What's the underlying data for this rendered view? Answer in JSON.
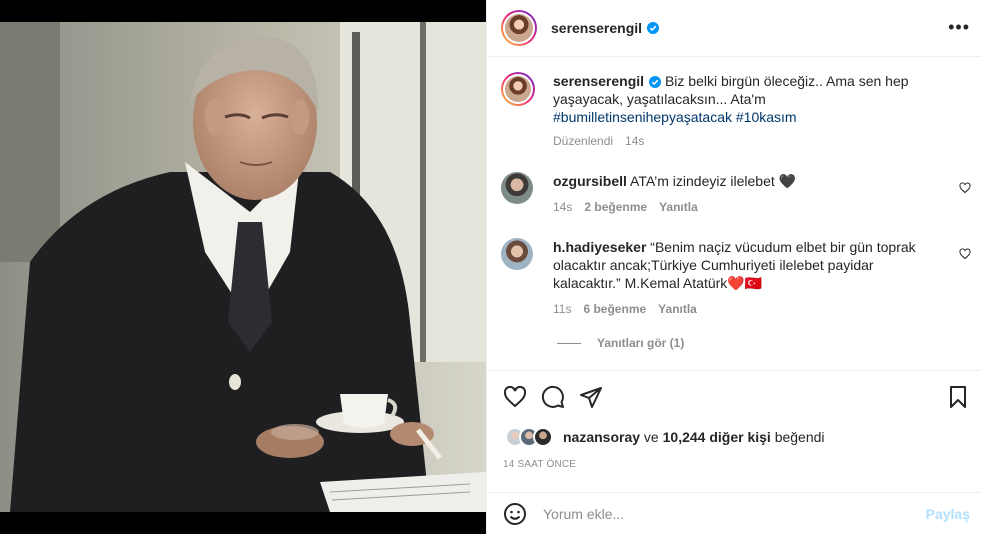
{
  "post": {
    "username": "serenserengil",
    "more_icon": "ellipsis-icon"
  },
  "caption": {
    "username": "serenserengil",
    "text": " Biz belki birgün öleceğiz.. Ama sen hep yaşayacak, yaşatılacaksın... Ata'm",
    "hashtags": "#bumilletinsenihepyaşatacak #10kasım",
    "edited": "Düzenlendi",
    "time": "14s"
  },
  "comments": [
    {
      "username": "ozgursibell",
      "text": " ATA’m izindeyiz ilelebet 🖤",
      "time": "14s",
      "likes": "2 beğenme",
      "reply": "Yanıtla"
    },
    {
      "username": "h.hadiyeseker",
      "text": " “Benim naçiz vücudum elbet bir gün toprak olacaktır ancak;Türkiye Cumhuriyeti ilelebet payidar kalacaktır.” M.Kemal Atatürk❤️🇹🇷",
      "time": "11s",
      "likes": "6 beğenme",
      "reply": "Yanıtla"
    }
  ],
  "view_replies": "Yanıtları gör (1)",
  "likes_line": {
    "user": "nazansoray",
    "middle": " ve ",
    "count": "10,244 diğer kişi",
    "suffix": " beğendi"
  },
  "time_ago": "14 SAAT ÖNCE",
  "composer": {
    "placeholder": "Yorum ekle...",
    "share_label": "Paylaş"
  },
  "colors": {
    "text": "#262626",
    "muted": "#8e8e8e",
    "link": "#00376b",
    "verified": "#0095f6",
    "share_disabled": "#b2dffc"
  }
}
